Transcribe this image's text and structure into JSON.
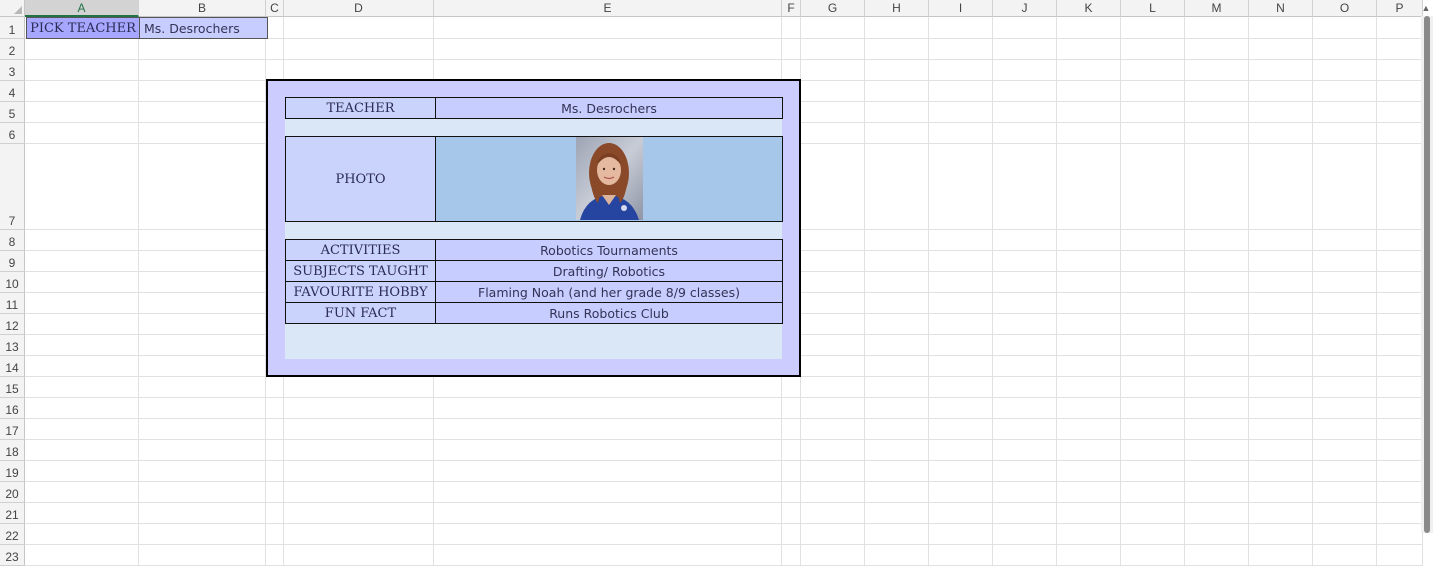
{
  "columns": [
    "A",
    "B",
    "C",
    "D",
    "E",
    "F",
    "G",
    "H",
    "I",
    "J",
    "K",
    "L",
    "M",
    "N",
    "O",
    "P"
  ],
  "rows": [
    "1",
    "2",
    "3",
    "4",
    "5",
    "6",
    "7",
    "8",
    "9",
    "10",
    "11",
    "12",
    "13",
    "14",
    "15",
    "16",
    "17",
    "18",
    "19",
    "20",
    "21",
    "22",
    "23"
  ],
  "selected_column": "A",
  "picker": {
    "label": "PICK TEACHER",
    "value": "Ms. Desrochers"
  },
  "card": {
    "teacher_label": "TEACHER",
    "teacher_value": "Ms. Desrochers",
    "photo_label": "PHOTO",
    "photo_desc": "teacher-portrait-photo",
    "activities_label": "ACTIVITIES",
    "activities_value": "Robotics Tournaments",
    "subjects_label": "SUBJECTS TAUGHT",
    "subjects_value": "Drafting/ Robotics",
    "hobby_label": "FAVOURITE HOBBY",
    "hobby_value": "Flaming Noah (and her grade 8/9 classes)",
    "funfact_label": "FUN FACT",
    "funfact_value": "Runs Robotics Club"
  },
  "colors": {
    "label_fill": "#c9d3fb",
    "value_fill": "#c8cdff",
    "picker_label_fill": "#a7a7ff",
    "photo_fill": "#a7c7ea",
    "inner_fill": "#dae7f7",
    "card_fill": "#ccccff",
    "header_selected": "#217346"
  }
}
